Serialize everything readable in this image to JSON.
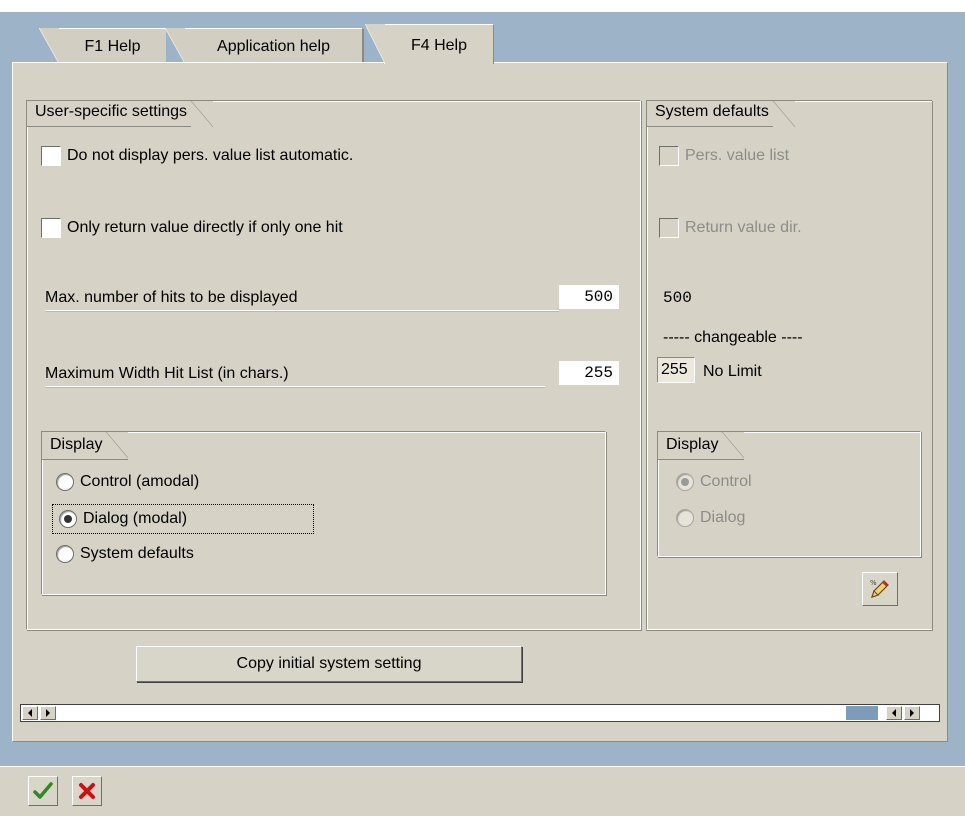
{
  "tabs": [
    {
      "label": "F1 Help"
    },
    {
      "label": "Application help"
    },
    {
      "label": "F4 Help"
    }
  ],
  "user_settings": {
    "title": "User-specific settings",
    "checkbox_no_auto_list": "Do not display pers. value list automatic.",
    "checkbox_return_direct": "Only return value directly if only one hit",
    "max_hits_label": "Max. number of hits to be displayed",
    "max_hits_value": "500",
    "max_width_label": "Maximum Width Hit List (in chars.)",
    "max_width_value": "255",
    "display": {
      "title": "Display",
      "options": [
        "Control (amodal)",
        "Dialog (modal)",
        "System defaults"
      ],
      "selected": "Dialog (modal)"
    },
    "copy_button": "Copy initial system setting"
  },
  "system_defaults": {
    "title": "System defaults",
    "checkbox_pers_list": "Pers. value list",
    "checkbox_return_dir": "Return value dir.",
    "max_hits_value": "500",
    "changeable_text": "----- changeable ----",
    "max_width_value": "255",
    "no_limit_text": "No Limit",
    "display": {
      "title": "Display",
      "options": [
        "Control",
        "Dialog"
      ],
      "selected": "Control"
    }
  },
  "icons": {
    "edit": "pencil-edit-icon",
    "confirm": "green-check-icon",
    "cancel": "red-x-icon"
  },
  "colors": {
    "window_bg": "#d6d3c6",
    "outer_bg": "#9db4c8",
    "scroll_thumb": "#7c9cba",
    "confirm_green": "#2e8b1f",
    "cancel_red": "#d01010"
  }
}
